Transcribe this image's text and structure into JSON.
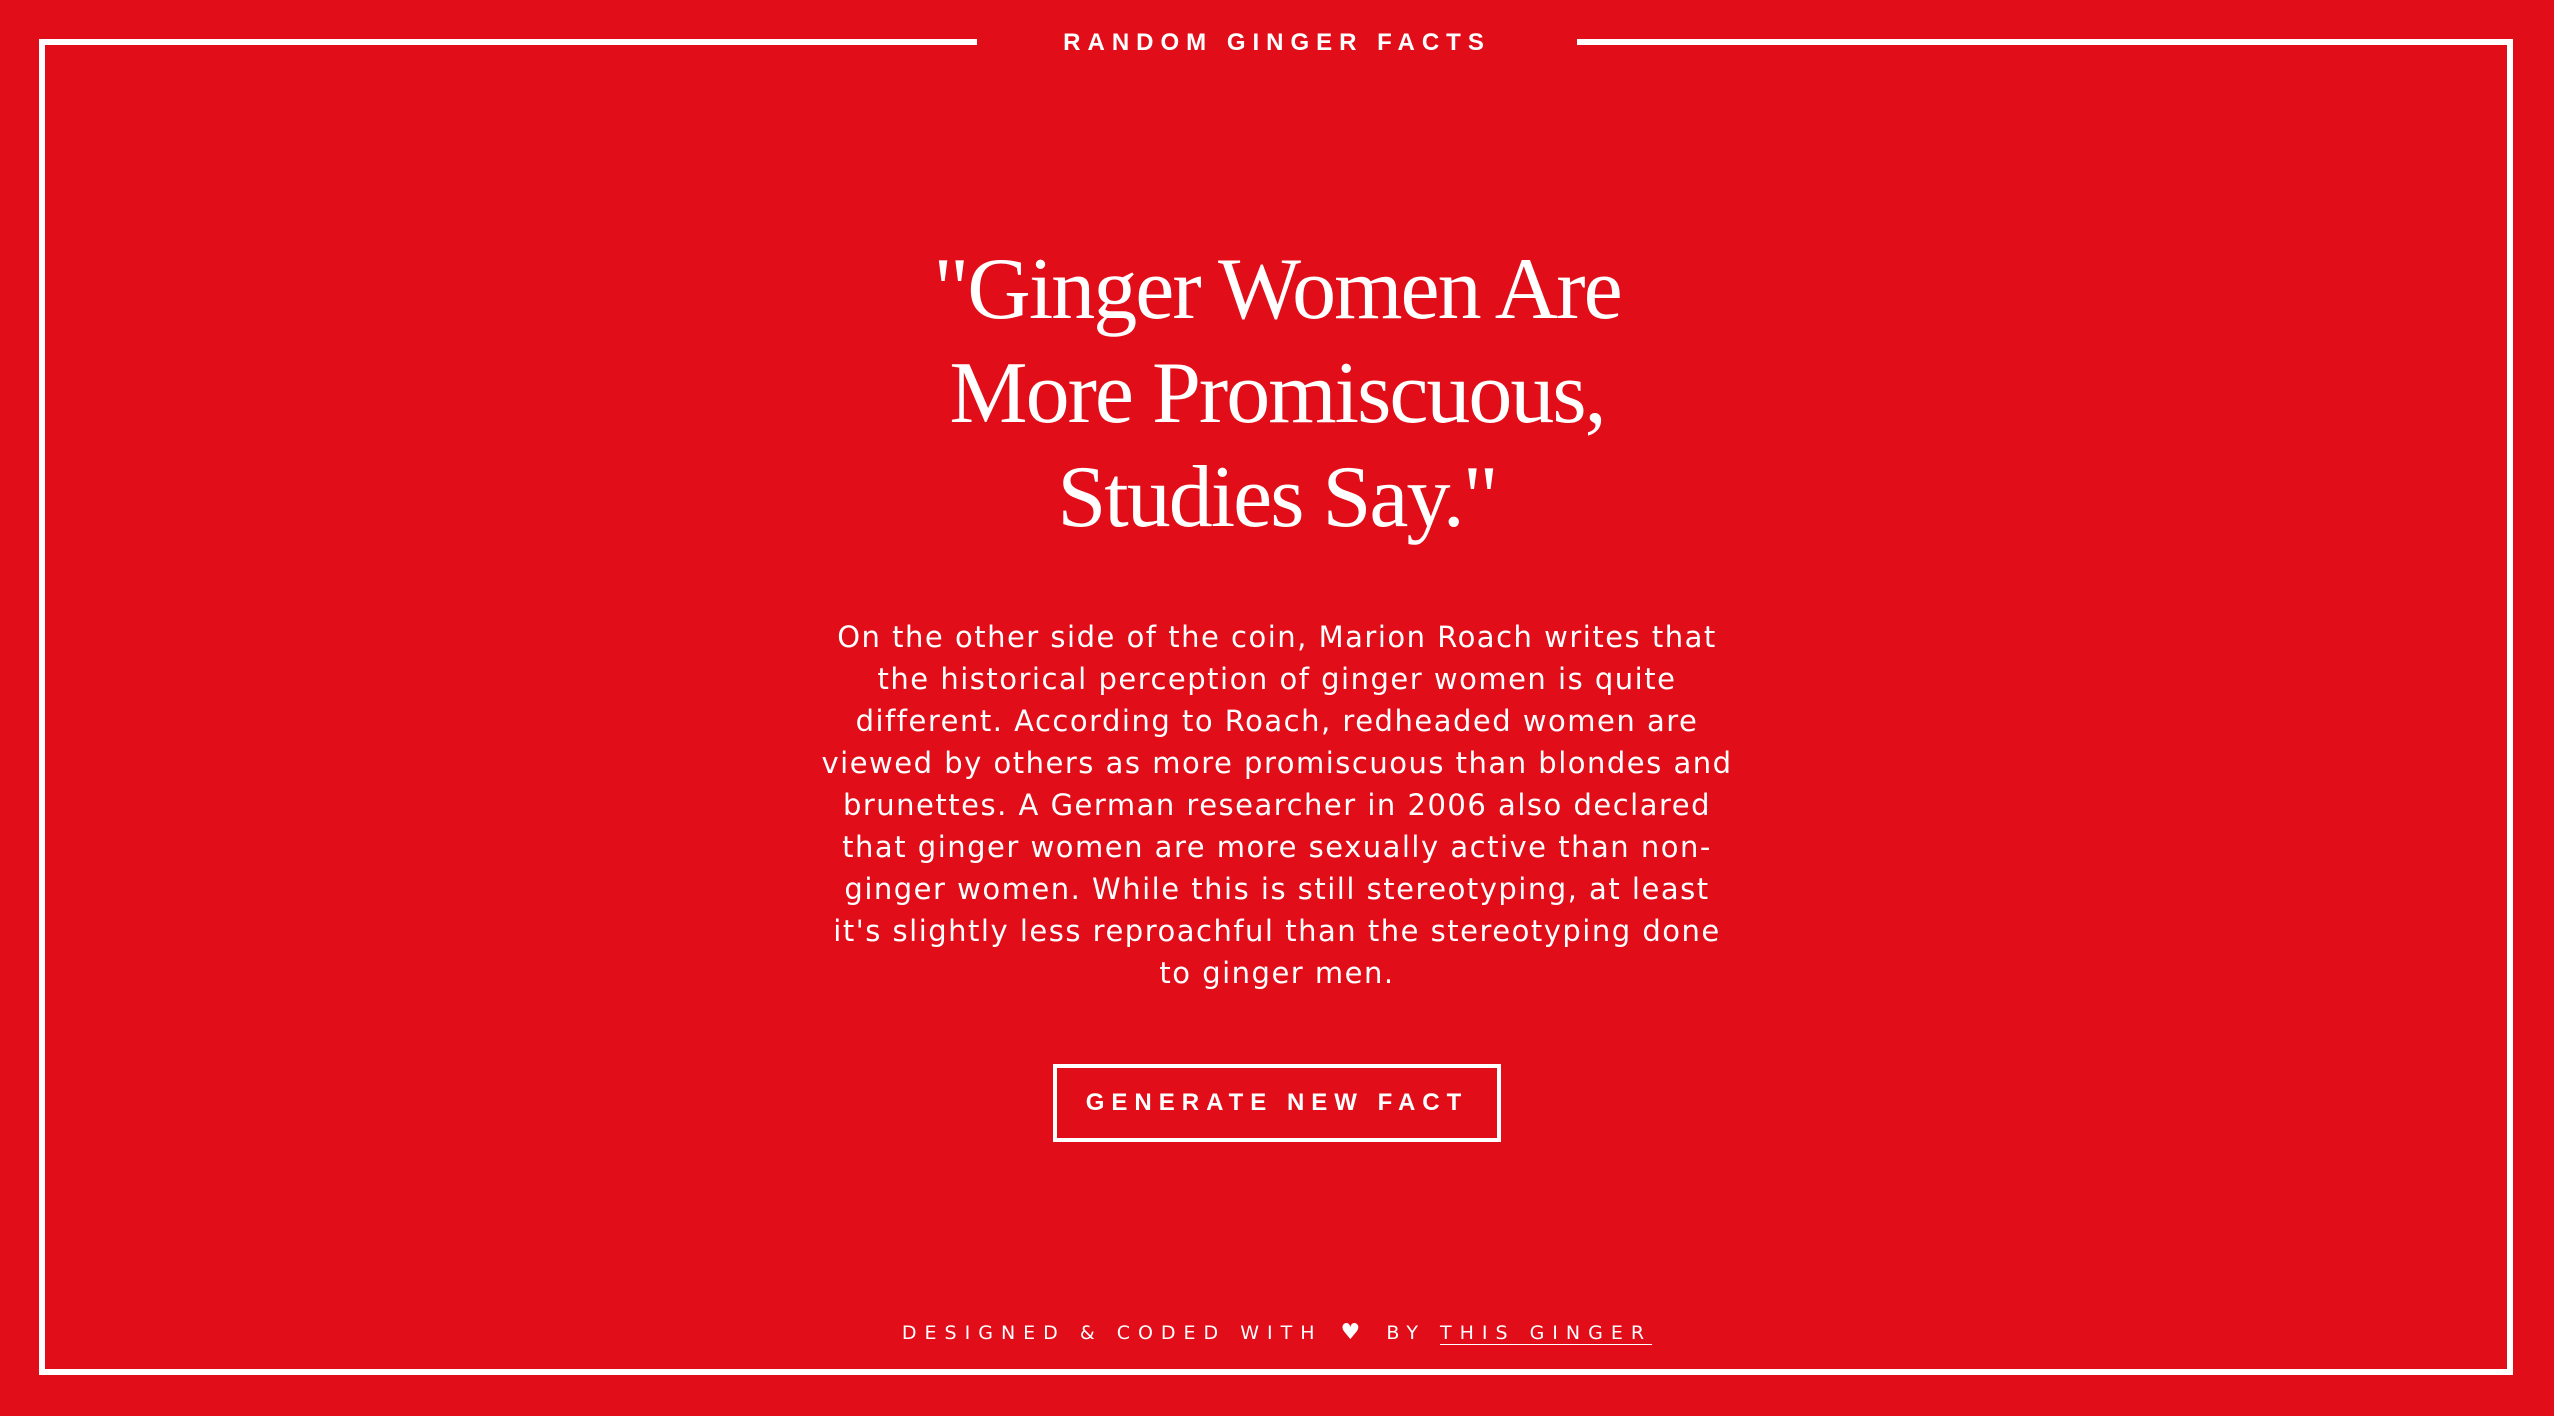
{
  "site": {
    "title": "RANDOM GINGER FACTS"
  },
  "fact": {
    "title_lines": [
      "\"Ginger Women Are",
      "More Promiscuous,",
      "Studies Say.\""
    ],
    "body": "On the other side of the coin, Marion Roach writes that the historical perception of ginger women is quite different. According to Roach, redheaded women are viewed by others as more promiscuous than blondes and brunettes. A German researcher in 2006 also declared that ginger women are more sexually active than non-ginger women. While this is still stereotyping, at least it's slightly less reproachful than the stereotyping done to ginger men."
  },
  "actions": {
    "generate_label": "GENERATE NEW FACT"
  },
  "footer": {
    "prefix": "DESIGNED & CODED WITH",
    "icon": "heart-icon",
    "by": "BY",
    "link_label": "THIS GINGER"
  },
  "colors": {
    "background": "#e10d19",
    "foreground": "#ffffff"
  }
}
